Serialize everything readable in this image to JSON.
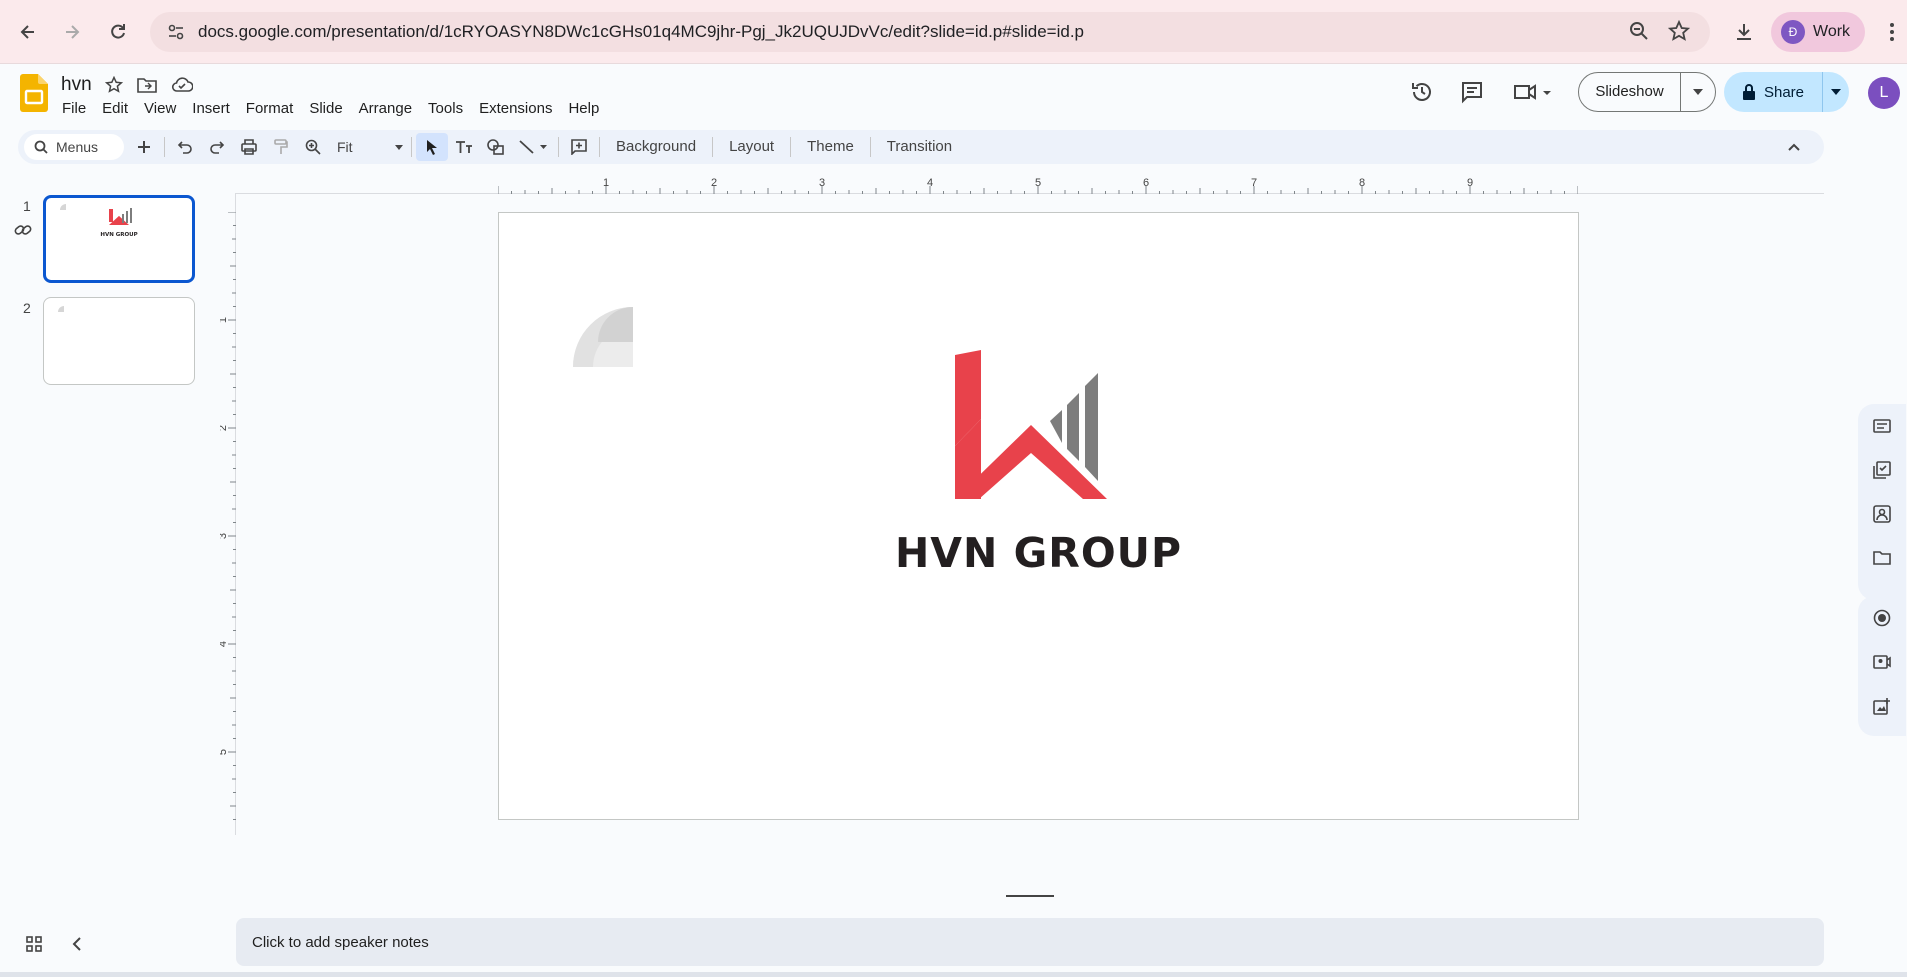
{
  "browser": {
    "url": "docs.google.com/presentation/d/1cRYOASYN8DWc1cGHs01q4MC9jhr-Pgj_Jk2UQUJDvVc/edit?slide=id.p#slide=id.p",
    "profile_initial": "Đ",
    "profile_label": "Work"
  },
  "app": {
    "title": "hvn",
    "menus": [
      "File",
      "Edit",
      "View",
      "Insert",
      "Format",
      "Slide",
      "Arrange",
      "Tools",
      "Extensions",
      "Help"
    ],
    "slideshow_label": "Slideshow",
    "share_label": "Share",
    "user_initial": "L"
  },
  "toolbar": {
    "search_label": "Menus",
    "zoom_value": "Fit",
    "background_label": "Background",
    "layout_label": "Layout",
    "theme_label": "Theme",
    "transition_label": "Transition"
  },
  "filmstrip": {
    "slides": [
      {
        "number": "1",
        "selected": true,
        "logo_text": "HVN GROUP"
      },
      {
        "number": "2",
        "selected": false
      }
    ]
  },
  "rulers": {
    "horizontal_labels": [
      "1",
      "2",
      "3",
      "4",
      "5",
      "6",
      "7",
      "8",
      "9"
    ],
    "vertical_labels": [
      "1",
      "2",
      "3",
      "4",
      "5"
    ]
  },
  "slide": {
    "logo_text": "HVN GROUP",
    "colors": {
      "red": "#e8424b",
      "gray": "#7d7d7d",
      "text": "#231f20"
    }
  },
  "notes": {
    "placeholder": "Click to add speaker notes"
  },
  "icons": {
    "back": "back-arrow-icon",
    "forward": "forward-arrow-icon",
    "reload": "reload-icon",
    "zoom": "zoom-icon",
    "bookmark": "star-icon",
    "download": "download-icon",
    "menu": "kebab-menu-icon"
  }
}
